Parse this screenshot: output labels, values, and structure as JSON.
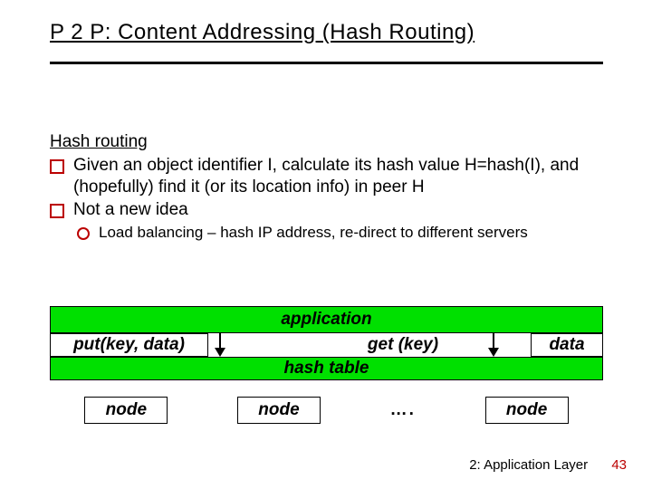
{
  "title": "P 2 P: Content Addressing (Hash Routing)",
  "subheading": "Hash routing",
  "bullets": [
    "Given an object identifier I, calculate its hash value H=hash(I), and (hopefully) find it (or its location info) in peer H",
    "Not a new idea"
  ],
  "subbullets": [
    "Load balancing – hash IP address, re-direct to different servers"
  ],
  "diagram": {
    "application": "application",
    "put": "put(key, data)",
    "get": "get (key)",
    "data": "data",
    "hash_table": "hash table",
    "node": "node",
    "dots": "…."
  },
  "footer": {
    "chapter": "2: Application Layer",
    "page": "43"
  }
}
